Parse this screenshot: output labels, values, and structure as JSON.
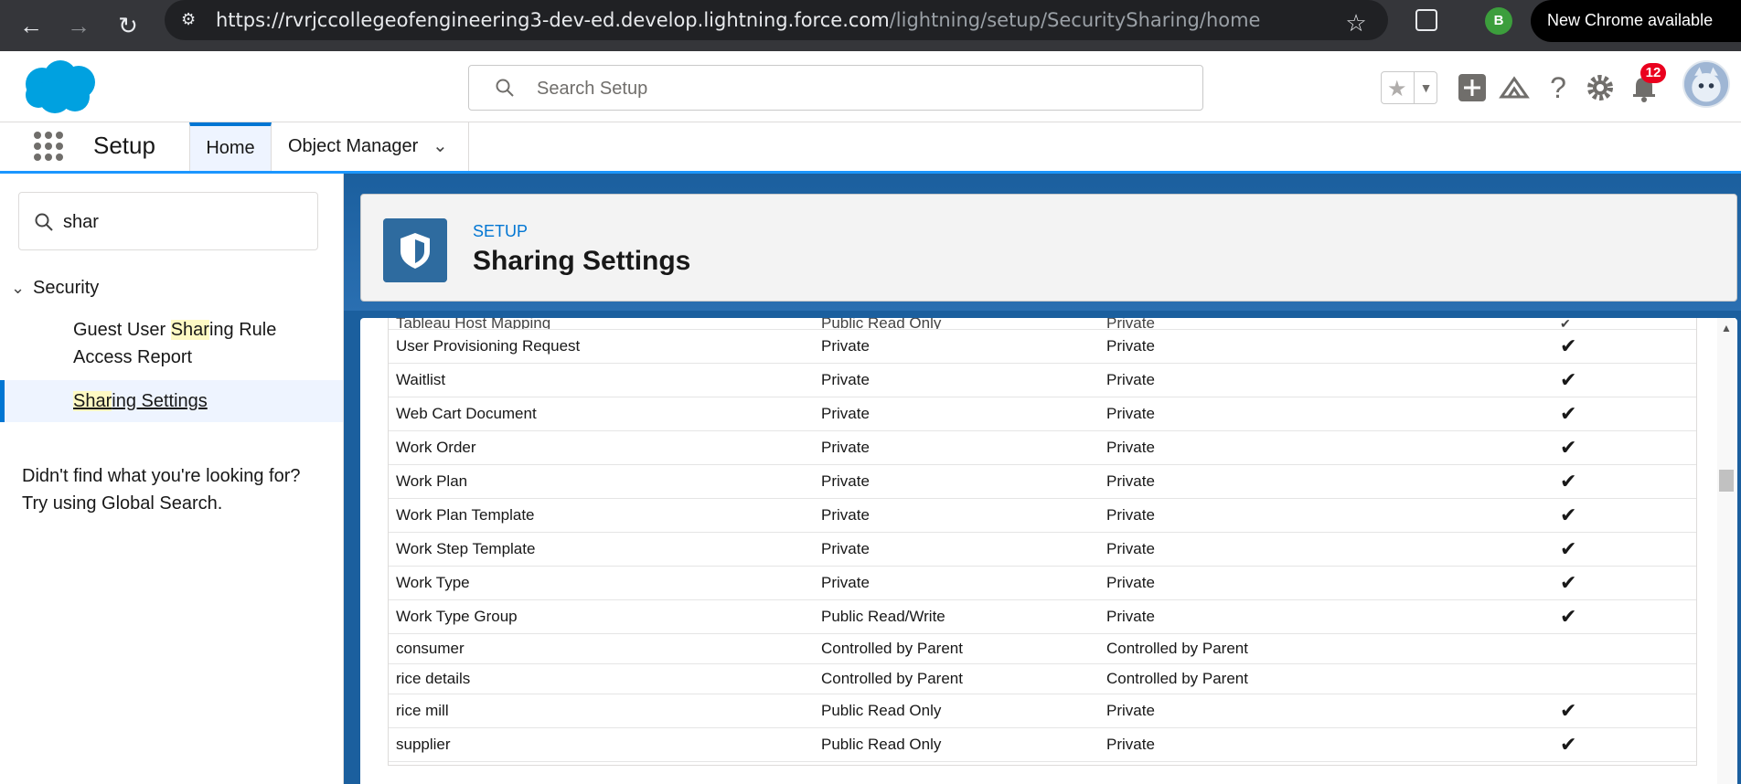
{
  "browser": {
    "url_host": "https://rvrjccollegeofengineering3-dev-ed.develop.lightning.force.com",
    "url_path": "/lightning/setup/SecuritySharing/home",
    "profile_initial": "B",
    "update_label": "New Chrome available"
  },
  "header": {
    "search_placeholder": "Search Setup",
    "notification_count": "12"
  },
  "app_nav": {
    "app_name": "Setup",
    "tabs": [
      {
        "label": "Home"
      },
      {
        "label": "Object Manager"
      }
    ]
  },
  "sidebar": {
    "search_value": "shar",
    "section": "Security",
    "items": [
      {
        "label_pre": "Guest User ",
        "label_hl": "Shar",
        "label_post": "ing Rule Access Report"
      },
      {
        "label_pre": "",
        "label_hl": "Shar",
        "label_post": "ing Settings"
      }
    ],
    "not_found_line1": "Didn't find what you're looking for?",
    "not_found_line2": "Try using Global Search."
  },
  "page": {
    "eyebrow": "SETUP",
    "title": "Sharing Settings"
  },
  "table": {
    "partial_row": {
      "object": "Tableau Host Mapping",
      "default_internal": "Public Read Only",
      "default_external": "Private"
    },
    "rows": [
      {
        "object": "User Provisioning Request",
        "default_internal": "Private",
        "default_external": "Private",
        "grant_hierarchy": "✔"
      },
      {
        "object": "Waitlist",
        "default_internal": "Private",
        "default_external": "Private",
        "grant_hierarchy": "✔"
      },
      {
        "object": "Web Cart Document",
        "default_internal": "Private",
        "default_external": "Private",
        "grant_hierarchy": "✔"
      },
      {
        "object": "Work Order",
        "default_internal": "Private",
        "default_external": "Private",
        "grant_hierarchy": "✔"
      },
      {
        "object": "Work Plan",
        "default_internal": "Private",
        "default_external": "Private",
        "grant_hierarchy": "✔"
      },
      {
        "object": "Work Plan Template",
        "default_internal": "Private",
        "default_external": "Private",
        "grant_hierarchy": "✔"
      },
      {
        "object": "Work Step Template",
        "default_internal": "Private",
        "default_external": "Private",
        "grant_hierarchy": "✔"
      },
      {
        "object": "Work Type",
        "default_internal": "Private",
        "default_external": "Private",
        "grant_hierarchy": "✔"
      },
      {
        "object": "Work Type Group",
        "default_internal": "Public Read/Write",
        "default_external": "Private",
        "grant_hierarchy": "✔"
      },
      {
        "object": "consumer",
        "default_internal": "Controlled by Parent",
        "default_external": "Controlled by Parent",
        "grant_hierarchy": ""
      },
      {
        "object": "rice details",
        "default_internal": "Controlled by Parent",
        "default_external": "Controlled by Parent",
        "grant_hierarchy": ""
      },
      {
        "object": "rice mill",
        "default_internal": "Public Read Only",
        "default_external": "Private",
        "grant_hierarchy": "✔"
      },
      {
        "object": "supplier",
        "default_internal": "Public Read Only",
        "default_external": "Private",
        "grant_hierarchy": "✔"
      }
    ]
  },
  "colors": {
    "brand_blue": "#0176d3",
    "header_bg": "#1b5f9e",
    "notif_red": "#ea001e",
    "highlight": "#fef9c3"
  }
}
